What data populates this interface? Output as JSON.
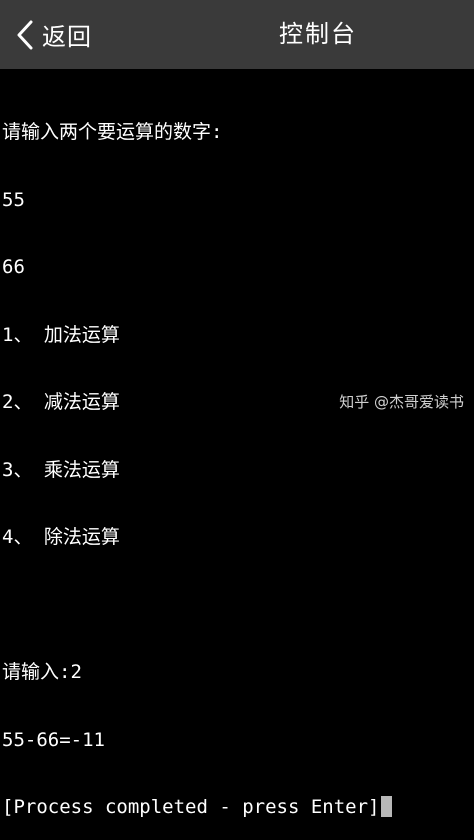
{
  "header": {
    "back_label": "返回",
    "title": "控制台",
    "background": "#3a3a3a"
  },
  "console": {
    "lines": [
      "请输入两个要运算的数字:",
      "55",
      "66",
      "1、 加法运算",
      "2、 减法运算",
      "3、 乘法运算",
      "4、 除法运算",
      "",
      "请输入:2",
      "55-66=-11",
      "[Process completed - press Enter]"
    ],
    "text_color": "#ffffff",
    "background": "#000000",
    "cursor_color": "#b8b8b8"
  },
  "watermark": {
    "text": "知乎 @杰哥爱读书"
  },
  "icons": {
    "back": "chevron-left-icon"
  }
}
